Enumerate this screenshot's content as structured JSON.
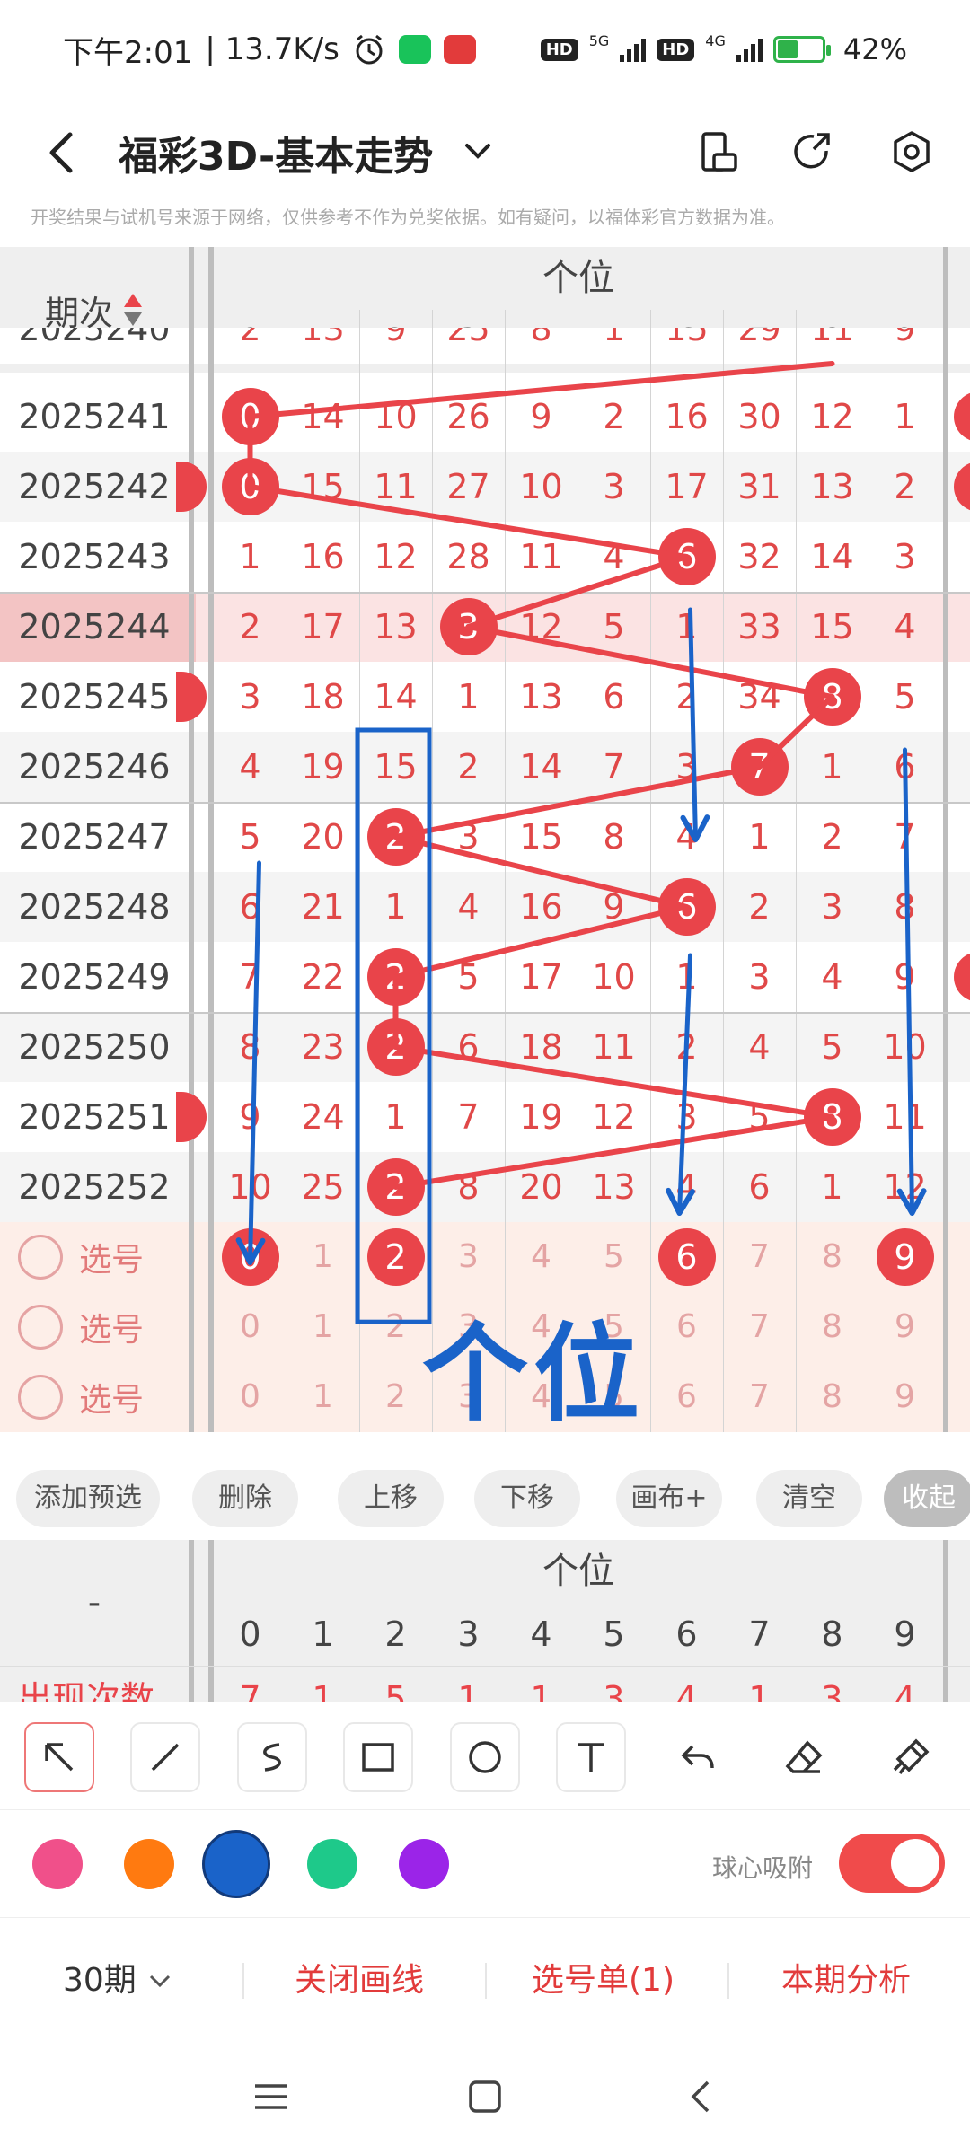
{
  "status": {
    "time": "下午2:01",
    "net_speed": "| 13.7K/s",
    "hd": "HD",
    "hd2": "HD",
    "net5g": "5G",
    "net4g": "4G",
    "battery": "42%",
    "battery_level": 0.42
  },
  "header": {
    "title": "福彩3D-基本走势",
    "notice": "开奖结果与试机号来源于网络，仅供参考不作为兑奖依据。如有疑问，以福体彩官方数据为准。"
  },
  "grid": {
    "period_header": "期次",
    "group_title": "个位",
    "digits": [
      "0",
      "1",
      "2",
      "3",
      "4",
      "5",
      "6",
      "7",
      "8",
      "9"
    ],
    "partial_row": {
      "period": "2025240",
      "cells": [
        "2",
        "13",
        "9",
        "25",
        "8",
        "1",
        "15",
        "29",
        "11",
        "9"
      ]
    },
    "rows": [
      {
        "period": "2025241",
        "hit": 0,
        "cells": [
          "0",
          "14",
          "10",
          "26",
          "9",
          "2",
          "16",
          "30",
          "12",
          "1"
        ]
      },
      {
        "period": "2025242",
        "hit": 0,
        "cells": [
          "0",
          "15",
          "11",
          "27",
          "10",
          "3",
          "17",
          "31",
          "13",
          "2"
        ]
      },
      {
        "period": "2025243",
        "hit": 6,
        "cells": [
          "1",
          "16",
          "12",
          "28",
          "11",
          "4",
          "6",
          "32",
          "14",
          "3"
        ]
      },
      {
        "period": "2025244",
        "hit": 3,
        "cells": [
          "2",
          "17",
          "13",
          "3",
          "12",
          "5",
          "1",
          "33",
          "15",
          "4"
        ]
      },
      {
        "period": "2025245",
        "hit": 8,
        "cells": [
          "3",
          "18",
          "14",
          "1",
          "13",
          "6",
          "2",
          "34",
          "8",
          "5"
        ]
      },
      {
        "period": "2025246",
        "hit": 7,
        "cells": [
          "4",
          "19",
          "15",
          "2",
          "14",
          "7",
          "3",
          "7",
          "1",
          "6"
        ]
      },
      {
        "period": "2025247",
        "hit": 2,
        "cells": [
          "5",
          "20",
          "2",
          "3",
          "15",
          "8",
          "4",
          "1",
          "2",
          "7"
        ]
      },
      {
        "period": "2025248",
        "hit": 6,
        "cells": [
          "6",
          "21",
          "1",
          "4",
          "16",
          "9",
          "6",
          "2",
          "3",
          "8"
        ]
      },
      {
        "period": "2025249",
        "hit": 2,
        "cells": [
          "7",
          "22",
          "2",
          "5",
          "17",
          "10",
          "1",
          "3",
          "4",
          "9"
        ]
      },
      {
        "period": "2025250",
        "hit": 2,
        "cells": [
          "8",
          "23",
          "2",
          "6",
          "18",
          "11",
          "2",
          "4",
          "5",
          "10"
        ]
      },
      {
        "period": "2025251",
        "hit": 8,
        "cells": [
          "9",
          "24",
          "1",
          "7",
          "19",
          "12",
          "3",
          "5",
          "8",
          "11"
        ]
      },
      {
        "period": "2025252",
        "hit": 2,
        "cells": [
          "10",
          "25",
          "2",
          "8",
          "20",
          "13",
          "4",
          "6",
          "1",
          "12"
        ]
      }
    ],
    "highlight_row_index": 3,
    "pick_rows": [
      {
        "label": "选号",
        "nums": [
          "0",
          "1",
          "2",
          "3",
          "4",
          "5",
          "6",
          "7",
          "8",
          "9"
        ],
        "selected": [
          0,
          2,
          6,
          9
        ]
      },
      {
        "label": "选号",
        "nums": [
          "0",
          "1",
          "2",
          "3",
          "4",
          "5",
          "6",
          "7",
          "8",
          "9"
        ],
        "selected": []
      },
      {
        "label": "选号",
        "nums": [
          "0",
          "1",
          "2",
          "3",
          "4",
          "5",
          "6",
          "7",
          "8",
          "9"
        ],
        "selected": []
      }
    ],
    "annotation_text": "个位"
  },
  "actions": [
    "添加预选",
    "删除",
    "上移",
    "下移",
    "画布+",
    "清空",
    "收起"
  ],
  "stats": {
    "row_label": "-",
    "group_title": "个位",
    "digits": [
      "0",
      "1",
      "2",
      "3",
      "4",
      "5",
      "6",
      "7",
      "8",
      "9"
    ],
    "partial_label": "出现次数",
    "partial_values": [
      "7",
      "1",
      "5",
      "1",
      "1",
      "3",
      "4",
      "1",
      "3",
      "4"
    ]
  },
  "tools": [
    "arrow-tool",
    "line-tool",
    "curve-tool",
    "rect-tool",
    "circle-tool",
    "text-tool",
    "undo-tool",
    "eraser-tool",
    "clear-tool"
  ],
  "colors": {
    "palette": [
      "#f0508a",
      "#ff7a10",
      "#1a63c9",
      "#1ec98a",
      "#9b24e8"
    ],
    "selected_index": 2,
    "accent": "#e9444a",
    "annotation": "#1a63c9"
  },
  "snap": {
    "label": "球心吸附",
    "on": true
  },
  "bottom": {
    "periods": "30期",
    "close_lines": "关闭画线",
    "pick_list": "选号单(1)",
    "analysis": "本期分析"
  }
}
